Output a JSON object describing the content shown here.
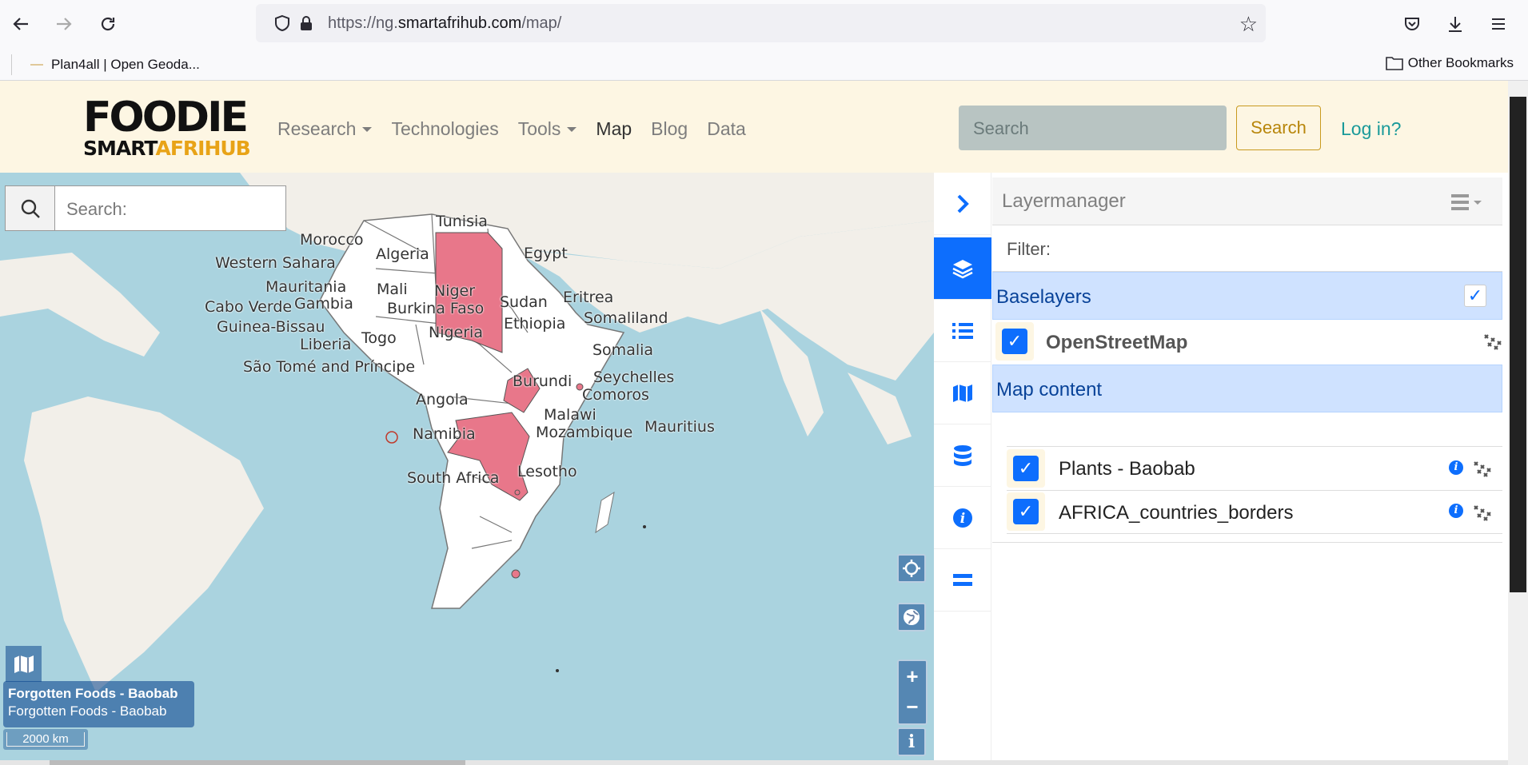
{
  "browser": {
    "url_prefix": "https://ng.",
    "url_domain": "smartafrihub.com",
    "url_path": "/map/",
    "bookmark": "Plan4all | Open Geoda...",
    "other_bookmarks": "Other Bookmarks"
  },
  "header": {
    "logo_top": "FOODIE",
    "logo_bottom_1": "SMART",
    "logo_bottom_2": "AFRIHUB",
    "nav": [
      "Research",
      "Technologies",
      "Tools",
      "Map",
      "Blog",
      "Data"
    ],
    "search_placeholder": "Search",
    "search_button": "Search",
    "login": "Log in?"
  },
  "map": {
    "search_placeholder": "Search:",
    "attribution_title": "Forgotten Foods - Baobab",
    "attribution_sub": "Forgotten Foods - Baobab",
    "scale": "2000 km",
    "labels": [
      "Tunisia",
      "Morocco",
      "Algeria",
      "Egypt",
      "Western Sahara",
      "Mauritania",
      "Mali",
      "Niger",
      "Eritrea",
      "Cabo Verde",
      "Gambia",
      "Burkina Faso",
      "Sudan",
      "Guinea-Bissau",
      "Nigeria",
      "Ethiopia",
      "Somaliland",
      "Togo",
      "Liberia",
      "Somalia",
      "São Tomé and Príncipe",
      "Seychelles",
      "Angola",
      "Burundi",
      "Comoros",
      "Malawi",
      "Mauritius",
      "Namibia",
      "Mozambique",
      "South Africa",
      "Lesotho"
    ],
    "highlight_color": "#e8778a",
    "water_color": "#aad3df"
  },
  "layermanager": {
    "title": "Layermanager",
    "filter": "Filter:",
    "baselayers_label": "Baselayers",
    "base": "OpenStreetMap",
    "map_content_label": "Map content",
    "layers": [
      "Plants - Baobab",
      "AFRICA_countries_borders"
    ]
  },
  "sidebar_icons": [
    "chevron-right-icon",
    "layers-icon",
    "list-icon",
    "map-icon",
    "database-icon",
    "info-icon",
    "equals-icon"
  ]
}
